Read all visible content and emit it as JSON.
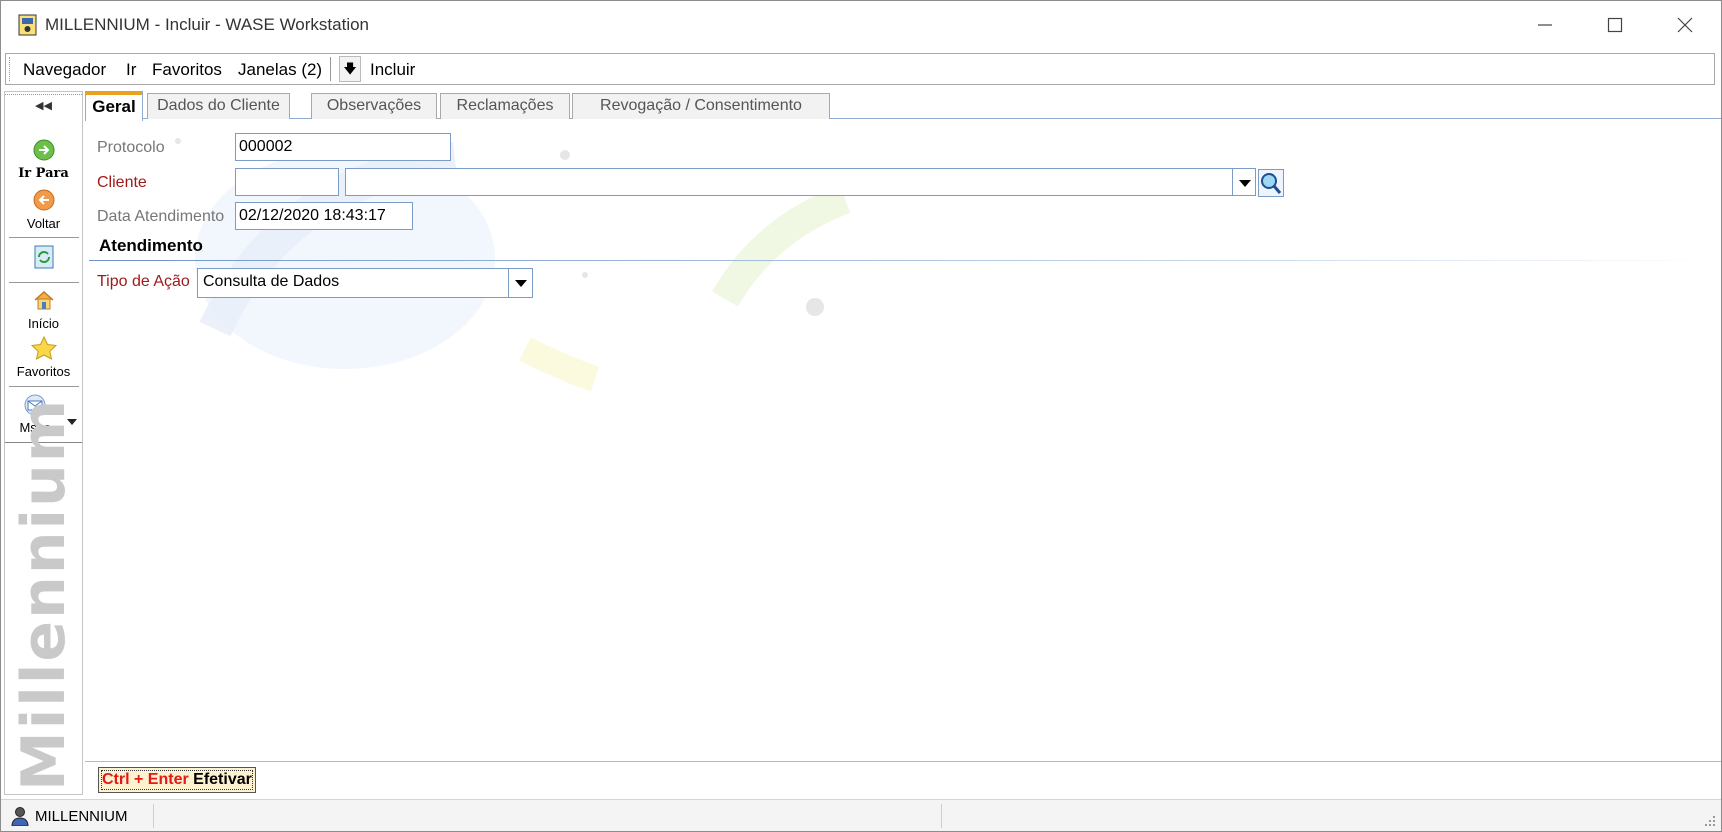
{
  "window": {
    "title": "MILLENNIUM - Incluir - WASE Workstation"
  },
  "menu": {
    "items": [
      "Navegador",
      "Ir",
      "Favoritos",
      "Janelas (2)"
    ],
    "location": "Incluir"
  },
  "toolbar": {
    "items": [
      {
        "label": "Ir Para",
        "icon": "go-arrow-icon"
      },
      {
        "label": "Voltar",
        "icon": "back-arrow-icon"
      },
      {
        "label": "",
        "icon": "refresh-icon"
      },
      {
        "label": "Início",
        "icon": "home-icon"
      },
      {
        "label": "Favoritos",
        "icon": "star-icon"
      },
      {
        "label": "Msgs",
        "icon": "envelope-icon"
      }
    ],
    "brand": "Millennium"
  },
  "tabs": [
    "Geral",
    "Dados do Cliente",
    "Observações",
    "Reclamações",
    "Revogação / Consentimento"
  ],
  "form": {
    "protocolo_label": "Protocolo",
    "protocolo_value": "000002",
    "cliente_label": "Cliente",
    "cliente_code": "",
    "cliente_name": "",
    "data_label": "Data Atendimento",
    "data_value": "02/12/2020 18:43:17",
    "section_title": "Atendimento",
    "tipo_label": "Tipo de Ação",
    "tipo_value": "Consulta de Dados"
  },
  "action": {
    "shortcut": "Ctrl + Enter",
    "label": "Efetivar"
  },
  "status": {
    "user": "MILLENNIUM"
  },
  "colors": {
    "required_label": "#a11a1a",
    "tab_accent": "#e9a21f",
    "field_border": "#7a9cc6",
    "shortcut": "#e31818"
  }
}
